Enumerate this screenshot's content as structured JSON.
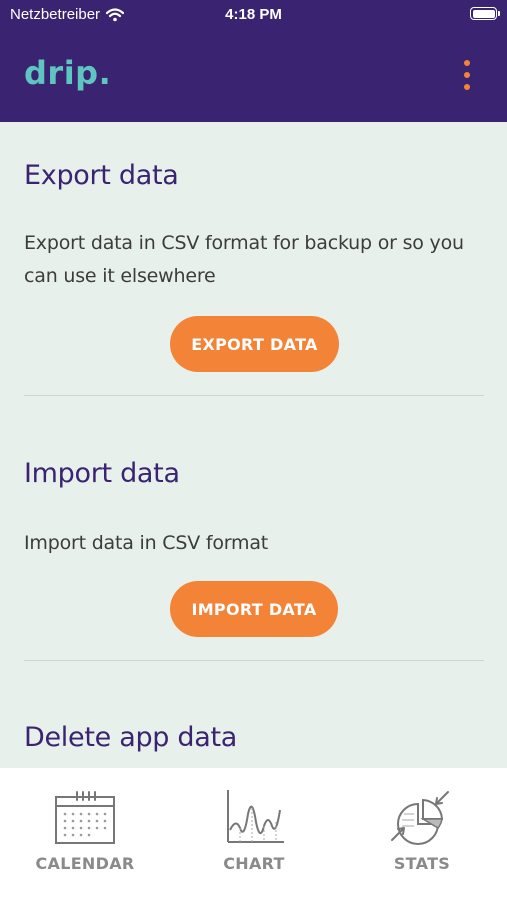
{
  "status_bar": {
    "carrier": "Netzbetreiber",
    "time": "4:18 PM"
  },
  "header": {
    "logo": "drip.",
    "menu_icon": "more-vertical-icon"
  },
  "export": {
    "title": "Export data",
    "description": "Export data in CSV format for backup or so you can use it elsewhere",
    "button": "EXPORT DATA"
  },
  "import": {
    "title": "Import data",
    "description": "Import data in CSV format",
    "button": "IMPORT DATA"
  },
  "delete": {
    "title": "Delete app data"
  },
  "tabs": [
    {
      "label": "CALENDAR",
      "icon": "calendar-icon"
    },
    {
      "label": "CHART",
      "icon": "chart-icon"
    },
    {
      "label": "STATS",
      "icon": "stats-icon"
    }
  ],
  "colors": {
    "header": "#3a2472",
    "accent": "#f38337",
    "logo": "#5fc5c0",
    "background": "#e8f0ec"
  }
}
